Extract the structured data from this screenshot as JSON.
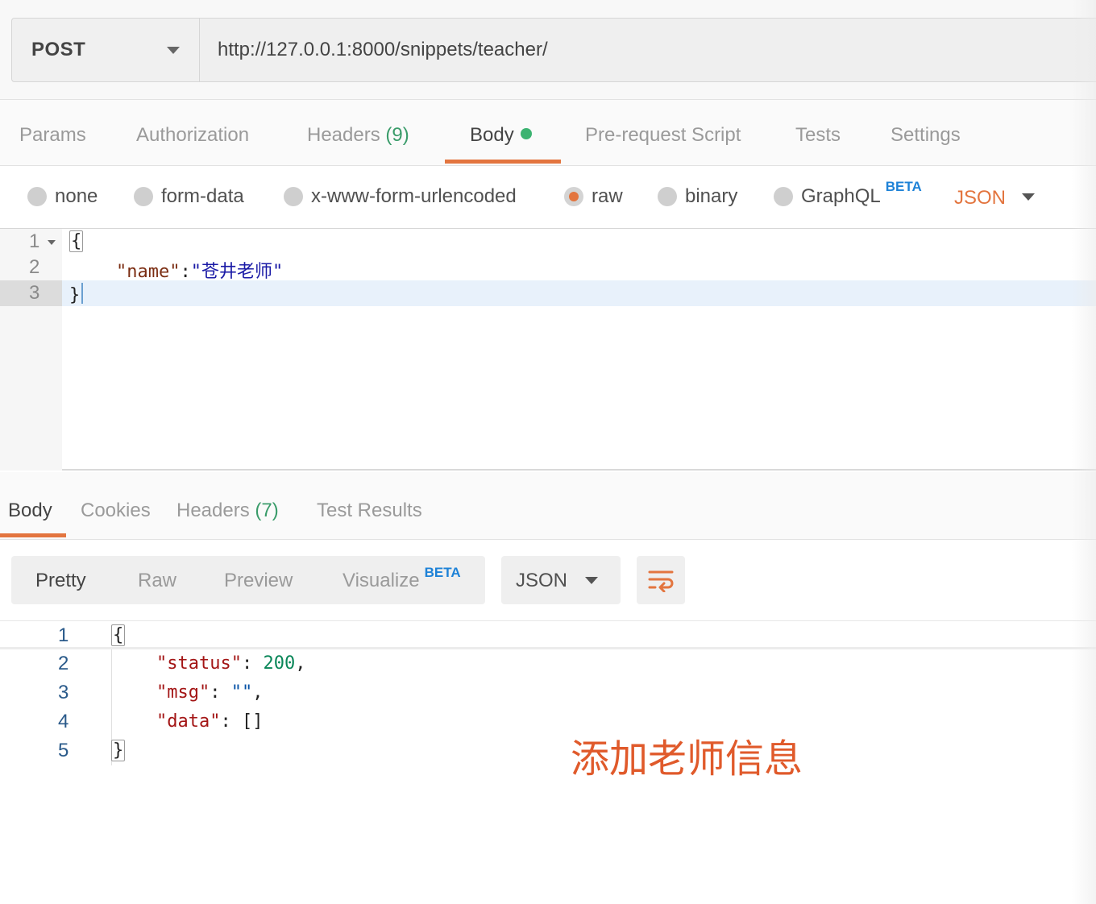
{
  "request": {
    "method": "POST",
    "url": "http://127.0.0.1:8000/snippets/teacher/"
  },
  "request_tabs": [
    {
      "label": "Params"
    },
    {
      "label": "Authorization"
    },
    {
      "label": "Headers",
      "count": "(9)"
    },
    {
      "label": "Body",
      "active": true,
      "indicator": "green-dot"
    },
    {
      "label": "Pre-request Script"
    },
    {
      "label": "Tests"
    },
    {
      "label": "Settings"
    }
  ],
  "body_types": {
    "options": [
      "none",
      "form-data",
      "x-www-form-urlencoded",
      "raw",
      "binary",
      "GraphQL"
    ],
    "selected": "raw",
    "graphql_badge": "BETA",
    "format": "JSON"
  },
  "request_body": {
    "lines": [
      {
        "num": "1",
        "text": "{"
      },
      {
        "num": "2",
        "key": "\"name\"",
        "sep": ":",
        "value": "\"苍井老师\""
      },
      {
        "num": "3",
        "text": "}"
      }
    ]
  },
  "response_tabs": [
    {
      "label": "Body",
      "active": true
    },
    {
      "label": "Cookies"
    },
    {
      "label": "Headers",
      "count": "(7)"
    },
    {
      "label": "Test Results"
    }
  ],
  "response_toolbar": {
    "views": [
      "Pretty",
      "Raw",
      "Preview",
      "Visualize"
    ],
    "active_view": "Pretty",
    "visualize_badge": "BETA",
    "format": "JSON",
    "wrap_icon": "wrap-lines-icon"
  },
  "response_body": {
    "lines": [
      {
        "num": "1",
        "text": "{"
      },
      {
        "num": "2",
        "key": "\"status\"",
        "value": "200",
        "tail": ","
      },
      {
        "num": "3",
        "key": "\"msg\"",
        "value": "\"\"",
        "tail": ","
      },
      {
        "num": "4",
        "key": "\"data\"",
        "value": "[]",
        "tail": ""
      },
      {
        "num": "5",
        "text": "}"
      }
    ]
  },
  "annotation": "添加老师信息",
  "colors": {
    "accent": "#e3753f",
    "count_green": "#3a9c6a",
    "beta_blue": "#1e82d7",
    "annotation_red": "#e05a2b"
  }
}
